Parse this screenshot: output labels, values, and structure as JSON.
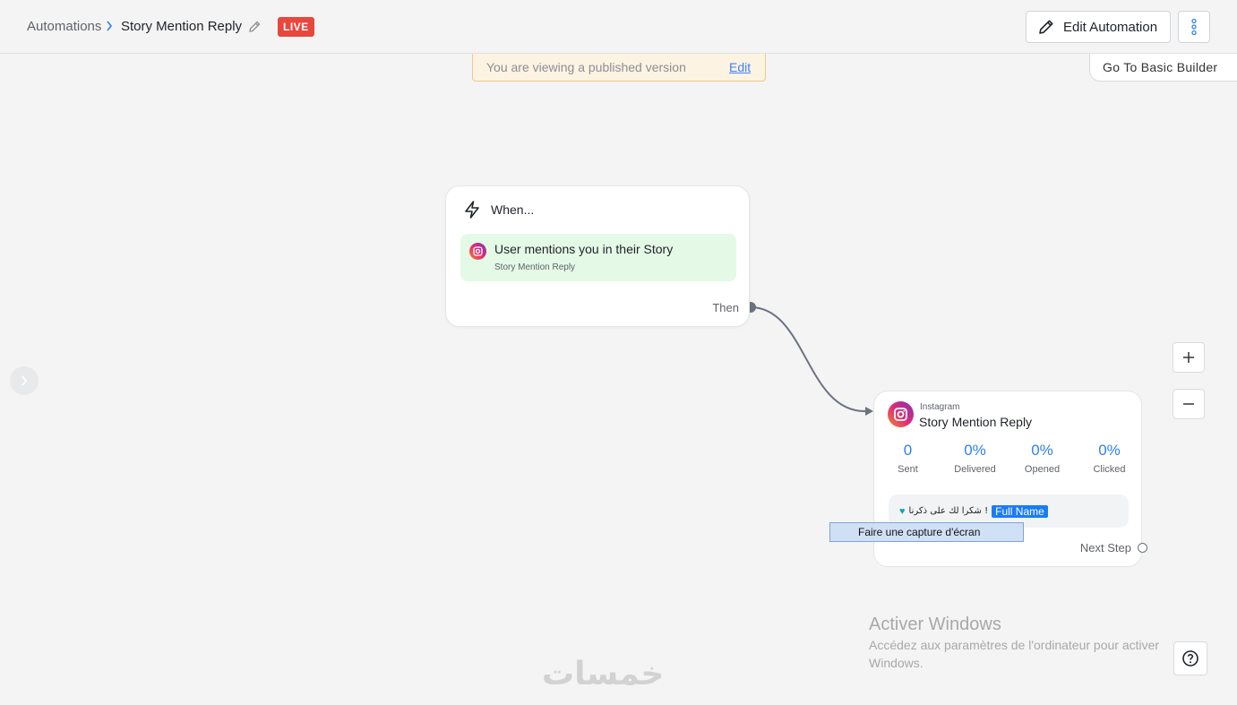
{
  "header": {
    "breadcrumb_root": "Automations",
    "title": "Story Mention Reply",
    "status_badge": "LIVE",
    "edit_button_label": "Edit Automation"
  },
  "banner": {
    "text": "You are viewing a published version",
    "edit_link": "Edit"
  },
  "basic_builder_label": "Go To Basic Builder",
  "trigger": {
    "heading": "When...",
    "item_title": "User mentions you in their Story",
    "item_subtitle": "Story Mention Reply",
    "then_label": "Then"
  },
  "action": {
    "platform": "Instagram",
    "title": "Story Mention Reply",
    "stats": [
      {
        "value": "0",
        "label": "Sent"
      },
      {
        "value": "0%",
        "label": "Delivered"
      },
      {
        "value": "0%",
        "label": "Opened"
      },
      {
        "value": "0%",
        "label": "Clicked"
      }
    ],
    "message_text": "شكرا لك على ذكرنا !",
    "message_variable": "Full Name",
    "next_step_label": "Next Step"
  },
  "tooltip": "Faire une capture d'écran",
  "windows_activation": {
    "title": "Activer Windows",
    "subtitle": "Accédez aux paramètres de l'ordinateur pour activer Windows."
  },
  "watermark": "خمسات",
  "colors": {
    "live": "#e8473d",
    "accent": "#2f80ed",
    "trigger_bg": "#e4f9e6",
    "variable_chip": "#1a7cf4"
  },
  "icons": {
    "trigger": "lightning-icon",
    "platform": "instagram-icon",
    "edit": "pencil-icon",
    "more": "vertical-dots-icon",
    "zoom_in": "plus-icon",
    "zoom_out": "minus-icon",
    "help": "question-icon"
  }
}
